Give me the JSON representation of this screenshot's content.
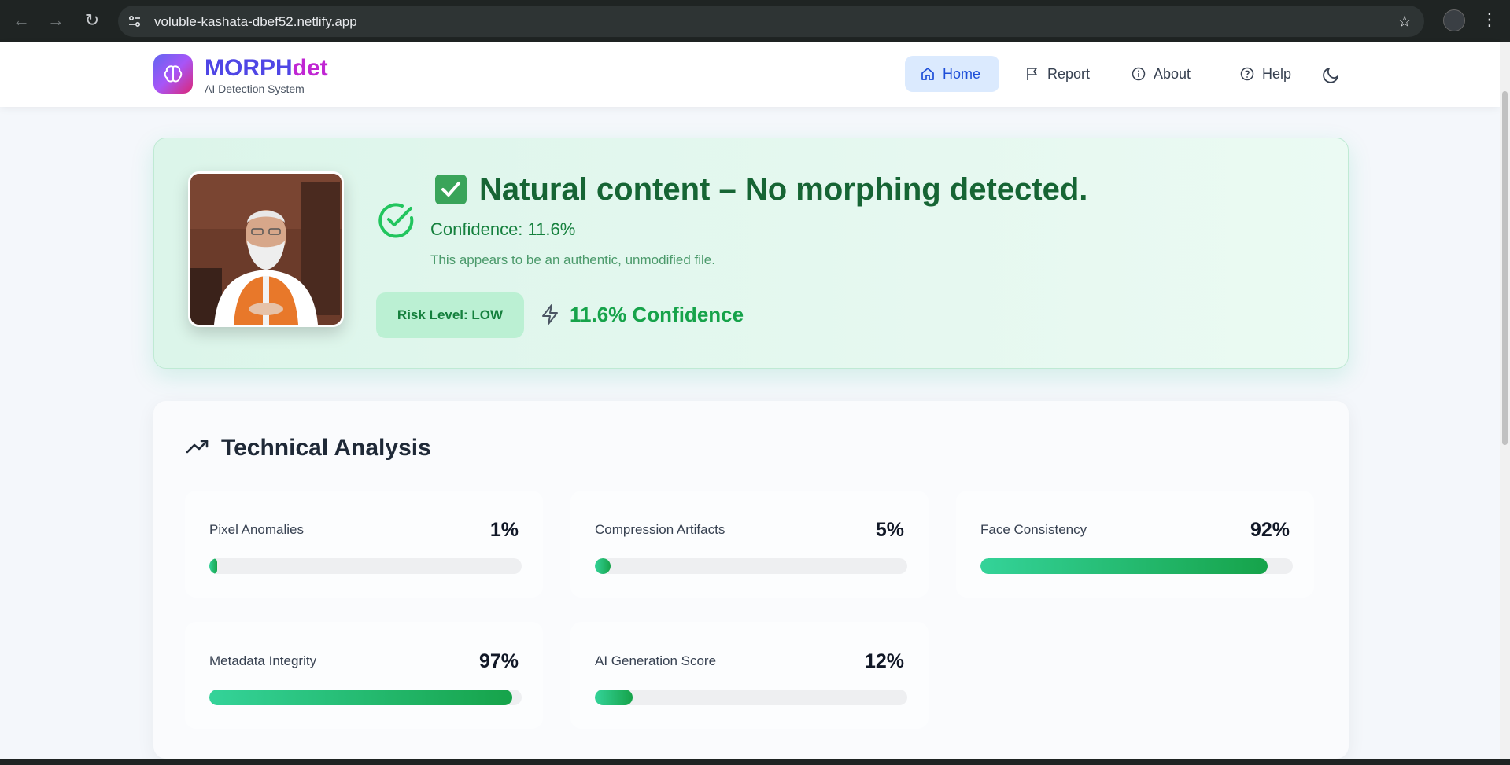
{
  "browser": {
    "url": "voluble-kashata-dbef52.netlify.app",
    "site_icon": "tune-icon",
    "bookmark_icon": "star-icon"
  },
  "header": {
    "brand_part1": "MORPH",
    "brand_part2": "det",
    "subtitle": "AI Detection System",
    "logo_icon": "brain-icon",
    "nav": {
      "home": "Home",
      "report": "Report",
      "about": "About",
      "help": "Help"
    },
    "theme_icon": "moon-icon"
  },
  "result": {
    "headline": "Natural content – No morphing detected.",
    "confidence_line": "Confidence: 11.6%",
    "description": "This appears to be an authentic, unmodified file.",
    "risk_badge": "Risk Level: LOW",
    "confidence_big": "11.6% Confidence",
    "colors": {
      "accent": "#16a34a",
      "headline": "#166534",
      "card_bg": "#dcf5ea"
    }
  },
  "analysis": {
    "title": "Technical Analysis",
    "metrics": [
      {
        "label": "Pixel Anomalies",
        "value": "1%",
        "fill": 0.01
      },
      {
        "label": "Compression Artifacts",
        "value": "5%",
        "fill": 0.05
      },
      {
        "label": "Face Consistency",
        "value": "92%",
        "fill": 0.92
      },
      {
        "label": "Metadata Integrity",
        "value": "97%",
        "fill": 0.97
      },
      {
        "label": "AI Generation Score",
        "value": "12%",
        "fill": 0.12
      }
    ]
  }
}
